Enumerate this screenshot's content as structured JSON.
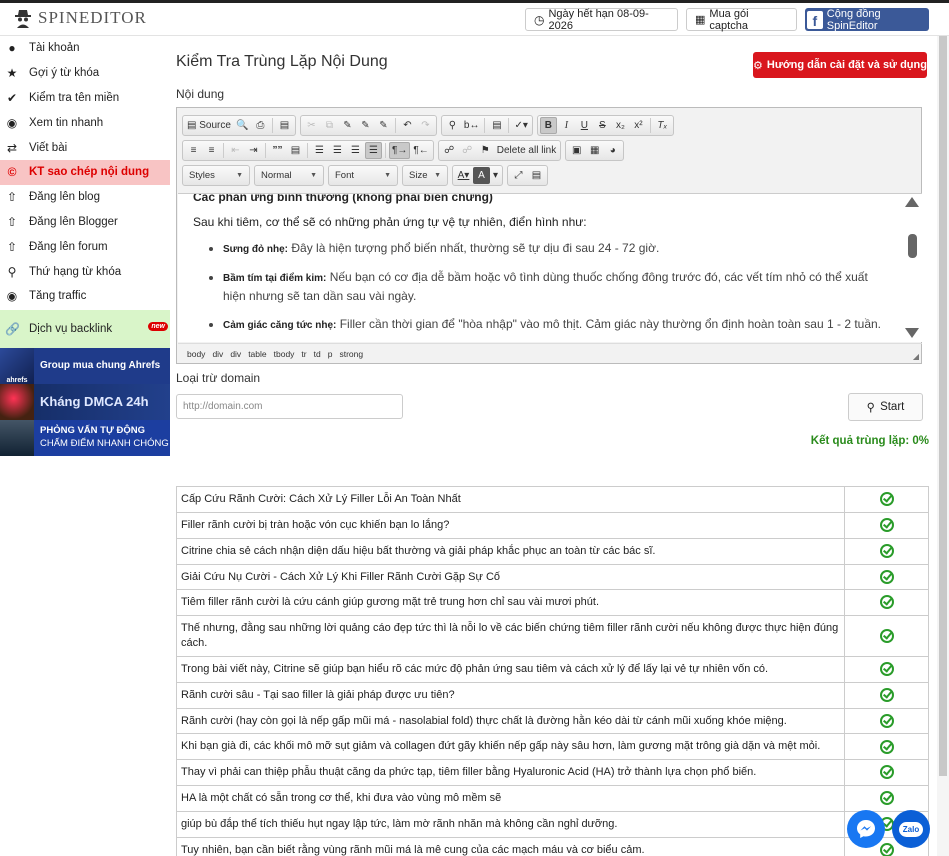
{
  "header": {
    "logo_text": "SPINEDITOR",
    "expiry_label": "Ngày hết hạn 08-09-2026",
    "captcha_label": "Mua gói captcha",
    "fb_label": "Cộng đồng SpinEditor"
  },
  "sidebar": {
    "items": [
      {
        "label": "Tài khoản",
        "icon": "user-icon"
      },
      {
        "label": "Gợi ý từ khóa",
        "icon": "star-icon"
      },
      {
        "label": "Kiểm tra tên miền",
        "icon": "check-icon"
      },
      {
        "label": "Xem tin nhanh",
        "icon": "eye-icon"
      },
      {
        "label": "Viết bài",
        "icon": "shuffle-icon"
      },
      {
        "label": "KT sao chép nội dung",
        "icon": "copyright-icon",
        "active": true
      },
      {
        "label": "Đăng lên blog",
        "icon": "upload-icon"
      },
      {
        "label": "Đăng lên Blogger",
        "icon": "upload-icon"
      },
      {
        "label": "Đăng lên forum",
        "icon": "upload-icon"
      },
      {
        "label": "Thứ hạng từ khóa",
        "icon": "search-icon"
      },
      {
        "label": "Tăng traffic",
        "icon": "eye-icon"
      }
    ],
    "backlink": {
      "label": "Dịch vụ backlink",
      "badge": "new"
    },
    "banners": [
      {
        "img_text": "ahrefs",
        "text": "Group mua chung Ahrefs"
      },
      {
        "text": "Kháng DMCA 24h"
      },
      {
        "line1": "PHỎNG VẤN TỰ ĐỘNG",
        "line2": "CHẤM ĐIỂM NHANH CHÓNG"
      }
    ]
  },
  "main": {
    "title": "Kiểm Tra Trùng Lặp Nội Dung",
    "guide_button": "Hướng dẫn cài đặt và sử dụng",
    "content_label": "Nội dung",
    "exclude_label": "Loại trừ domain",
    "domain_placeholder": "http://domain.com",
    "start_label": "Start",
    "result_label": "Kết quả trùng lặp: 0%"
  },
  "editor": {
    "source_label": "Source",
    "delete_links_label": "Delete all link",
    "styles_label": "Styles",
    "format_label": "Normal",
    "font_label": "Font",
    "size_label": "Size",
    "para_cut": "Các phản ứng bình thường (không phải biến chứng)",
    "para_intro": "Sau khi tiêm, cơ thể sẽ có những phản ứng tự vệ tự nhiên, điển hình như:",
    "bullets": [
      {
        "bold": "Sưng đỏ nhẹ:",
        "text": " Đây là hiện tượng phổ biến nhất, thường sẽ tự dịu đi sau 24 - 72 giờ."
      },
      {
        "bold": "Bầm tím tại điểm kim:",
        "text": " Nếu bạn có cơ địa dễ bầm hoặc vô tình dùng thuốc chống đông trước đó, các vết tím nhỏ có thể xuất hiện nhưng sẽ tan dần sau vài ngày."
      },
      {
        "bold": "Cảm giác căng tức nhẹ:",
        "text": " Filler cần thời gian để \"hòa nhập\" vào mô thịt. Cảm giác này thường ổn định hoàn toàn sau 1 - 2 tuần."
      }
    ],
    "path": [
      "body",
      "div",
      "div",
      "table",
      "tbody",
      "tr",
      "td",
      "p",
      "strong"
    ]
  },
  "results": [
    "Cấp Cứu Rãnh Cười: Cách Xử Lý Filler Lỗi An Toàn Nhất",
    "Filler rãnh cười bị tràn hoặc vón cục khiến bạn lo lắng?",
    "Citrine chia sẻ cách nhận diện dấu hiệu bất thường và giải pháp khắc phục an toàn từ các bác sĩ.",
    "Giải Cứu Nụ Cười - Cách Xử Lý Khi Filler Rãnh Cười Gặp Sự Cố",
    "Tiêm filler rãnh cười là cứu cánh giúp gương mặt trẻ trung hơn chỉ sau vài mươi phút.",
    "Thế nhưng, đằng sau những lời quảng cáo đẹp tức thì là nỗi lo về các biến chứng tiêm filler rãnh cười nếu không được thực hiện đúng cách.",
    "Trong bài viết này, Citrine sẽ giúp bạn hiểu rõ các mức độ phản ứng sau tiêm và cách xử lý để lấy lại vẻ tự nhiên vốn có.",
    "Rãnh cười sâu - Tại sao filler là giải pháp được ưu tiên?",
    "Rãnh cười (hay còn gọi là nếp gấp mũi má - nasolabial fold) thực chất là đường hằn kéo dài từ cánh mũi xuống khóe miệng.",
    "Khi bạn già đi, các khối mô mỡ sụt giảm và collagen đứt gãy khiến nếp gấp này sâu hơn, làm gương mặt trông già dặn và mệt mỏi.",
    "Thay vì phải can thiệp phẫu thuật căng da phức tạp, tiêm filler bằng Hyaluronic Acid (HA) trở thành lựa chọn phổ biến.",
    "HA là một chất có sẵn trong cơ thể, khi đưa vào vùng mô mềm sẽ",
    "giúp bù đắp thể tích thiếu hụt ngay lập tức, làm mờ rãnh nhăn mà không cần nghỉ dưỡng.",
    "Tuy nhiên, bạn cần biết rằng vùng rãnh mũi má là mê cung của các mạch máu và cơ biểu cảm."
  ],
  "floating": {
    "zalo_label": "Zalo"
  },
  "colors": {
    "accent_red": "#d9161d",
    "active_bg": "#f8c4c4",
    "success_green": "#2a8b1c",
    "facebook_blue": "#3b5998"
  }
}
